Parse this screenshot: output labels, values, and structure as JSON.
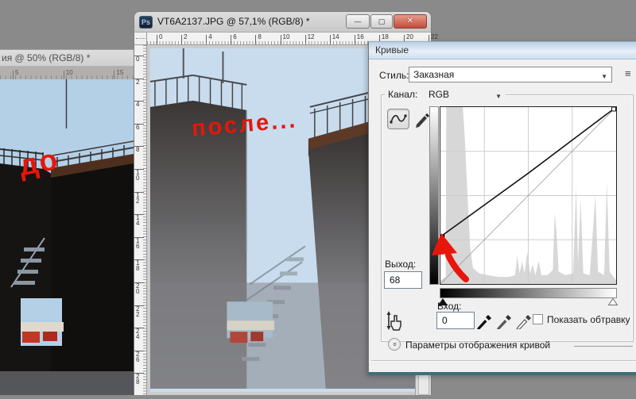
{
  "colors": {
    "workspace_gray": "#8a8a8a",
    "annotation_red": "#e8150b",
    "dialog_titlebar_blue": "#b9d0e6",
    "close_button_red": "#c24c3b",
    "histogram_gray": "#d7d7d7"
  },
  "left_window": {
    "title": "ия @ 50% (RGB/8) *",
    "ruler": {
      "labels": [
        "5",
        "10",
        "15"
      ]
    },
    "annotation": "до"
  },
  "main_window": {
    "app_icon": "Ps",
    "title": "VT6A2137.JPG @ 57,1% (RGB/8) *",
    "window_controls": {
      "minimize": "—",
      "maximize": "▢",
      "close": "✕"
    },
    "h_ruler": {
      "labels": [
        "0",
        "2",
        "4",
        "6",
        "8",
        "10",
        "12",
        "14",
        "16",
        "18",
        "20",
        "22"
      ]
    },
    "v_ruler": {
      "labels": [
        "0",
        "2",
        "4",
        "6",
        "8",
        "10",
        "12",
        "14",
        "16",
        "18",
        "20",
        "22",
        "24",
        "26",
        "28"
      ]
    },
    "annotation": "после..."
  },
  "curves_dialog": {
    "title": "Кривые",
    "style": {
      "label": "Стиль:",
      "value": "Заказная"
    },
    "channel": {
      "label": "Канал:",
      "value": "RGB"
    },
    "output": {
      "label": "Выход:",
      "value": "68"
    },
    "input": {
      "label": "Вход:",
      "value": "0"
    },
    "clipping": {
      "label": "Показать обтравку",
      "checked": false
    },
    "expander": {
      "label": "Параметры отображения кривой"
    },
    "graph": {
      "type": "curves",
      "axis_range": [
        0,
        255
      ],
      "grid_divisions": 4,
      "baseline": [
        [
          0,
          0
        ],
        [
          255,
          255
        ]
      ],
      "curve_points": [
        [
          0,
          68
        ],
        [
          128,
          160
        ],
        [
          255,
          255
        ]
      ],
      "selected_point": {
        "input": 0,
        "output": 68
      },
      "histogram": [
        [
          0,
          0.02
        ],
        [
          0.03,
          0.04
        ],
        [
          0.033,
          1
        ],
        [
          0.128,
          1
        ],
        [
          0.14,
          0.8
        ],
        [
          0.155,
          0.48
        ],
        [
          0.17,
          0.2
        ],
        [
          0.185,
          0.09
        ],
        [
          0.22,
          0.06
        ],
        [
          0.27,
          0.05
        ],
        [
          0.33,
          0.04
        ],
        [
          0.39,
          0.04
        ],
        [
          0.425,
          0.05
        ],
        [
          0.437,
          0.16
        ],
        [
          0.45,
          0.06
        ],
        [
          0.465,
          0.13
        ],
        [
          0.478,
          0.06
        ],
        [
          0.495,
          0.18
        ],
        [
          0.51,
          0.06
        ],
        [
          0.525,
          0.11
        ],
        [
          0.54,
          0.05
        ],
        [
          0.56,
          0.13
        ],
        [
          0.575,
          0.05
        ],
        [
          0.61,
          0.05
        ],
        [
          0.64,
          0.08
        ],
        [
          0.65,
          0.4
        ],
        [
          0.66,
          0.3
        ],
        [
          0.673,
          0.07
        ],
        [
          0.71,
          0.05
        ],
        [
          0.755,
          0.06
        ],
        [
          0.772,
          0.55
        ],
        [
          0.783,
          0.12
        ],
        [
          0.798,
          0.48
        ],
        [
          0.813,
          0.06
        ],
        [
          0.85,
          0.05
        ],
        [
          0.882,
          0.5
        ],
        [
          0.897,
          0.07
        ],
        [
          0.932,
          0.05
        ],
        [
          0.947,
          0.58
        ],
        [
          0.963,
          0.07
        ],
        [
          0.985,
          0.04
        ],
        [
          1,
          0.02
        ]
      ]
    }
  },
  "icons": {
    "chevron_down": "▼",
    "preset_menu": "≡",
    "curve_tool": "∿",
    "collapse_chevron": "»"
  }
}
